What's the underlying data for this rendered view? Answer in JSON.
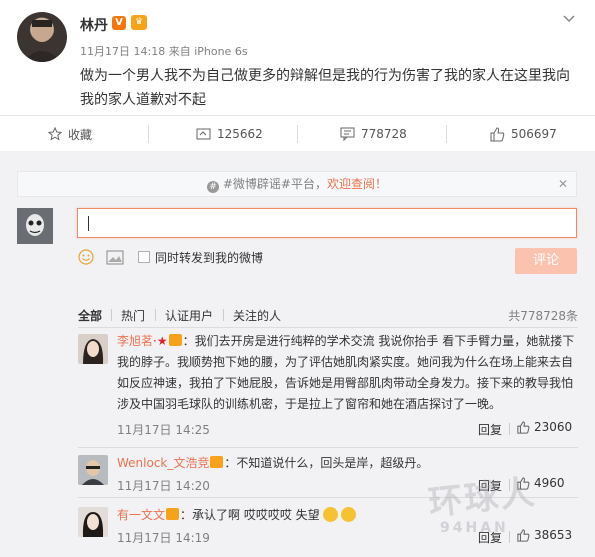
{
  "post": {
    "author": "林丹",
    "v_badge": "V",
    "time": "11月17日 14:18",
    "source": "来自 iPhone 6s",
    "content": "做为一个男人我不为自己做更多的辩解但是我的行为伤害了我的家人在这里我向我的家人道歉对不起"
  },
  "actions": {
    "favorite": "收藏",
    "repost": "125662",
    "comment": "778728",
    "like": "506697"
  },
  "notice": {
    "prefix": "#微博辟谣#平台，",
    "highlight": "欢迎查阅！",
    "close": "✕"
  },
  "composer": {
    "input_value": "",
    "repost_label": "同时转发到我的微博",
    "submit": "评论"
  },
  "filters": {
    "tabs": [
      "全部",
      "热门",
      "认证用户",
      "关注的人"
    ],
    "total": "共778728条"
  },
  "comments": [
    {
      "name": "李旭茗",
      "text": "我们去开房是进行纯粹的学术交流 我说你抬手 看下手臂力量，她就搂下我的脖子。我顺势抱下她的腰，为了评估她肌肉紧实度。她问我为什么在场上能来去自如反应神速，我拍了下她屁股，告诉她是用臀部肌肉带动全身发力。接下来的教导我怕涉及中国羽毛球队的训练机密，于是拉上了窗帘和她在酒店探讨了一晚。",
      "time": "11月17日 14:25",
      "reply": "回复",
      "likes": "23060"
    },
    {
      "name": "Wenlock_文浩竞",
      "text": "不知道说什么，回头是岸，超级丹。",
      "time": "11月17日 14:20",
      "reply": "回复",
      "likes": "4960"
    },
    {
      "name": "有一文文",
      "text": "承认了啊  哎哎哎哎 失望",
      "time": "11月17日 14:19",
      "reply": "回复",
      "likes": "38653"
    }
  ],
  "watermark": {
    "main": "环球人",
    "sub": "94HAN"
  },
  "colors": {
    "accent": "#eb7350",
    "submit_disabled": "#fbc3ae",
    "panel_bg": "#f2f2f5"
  }
}
